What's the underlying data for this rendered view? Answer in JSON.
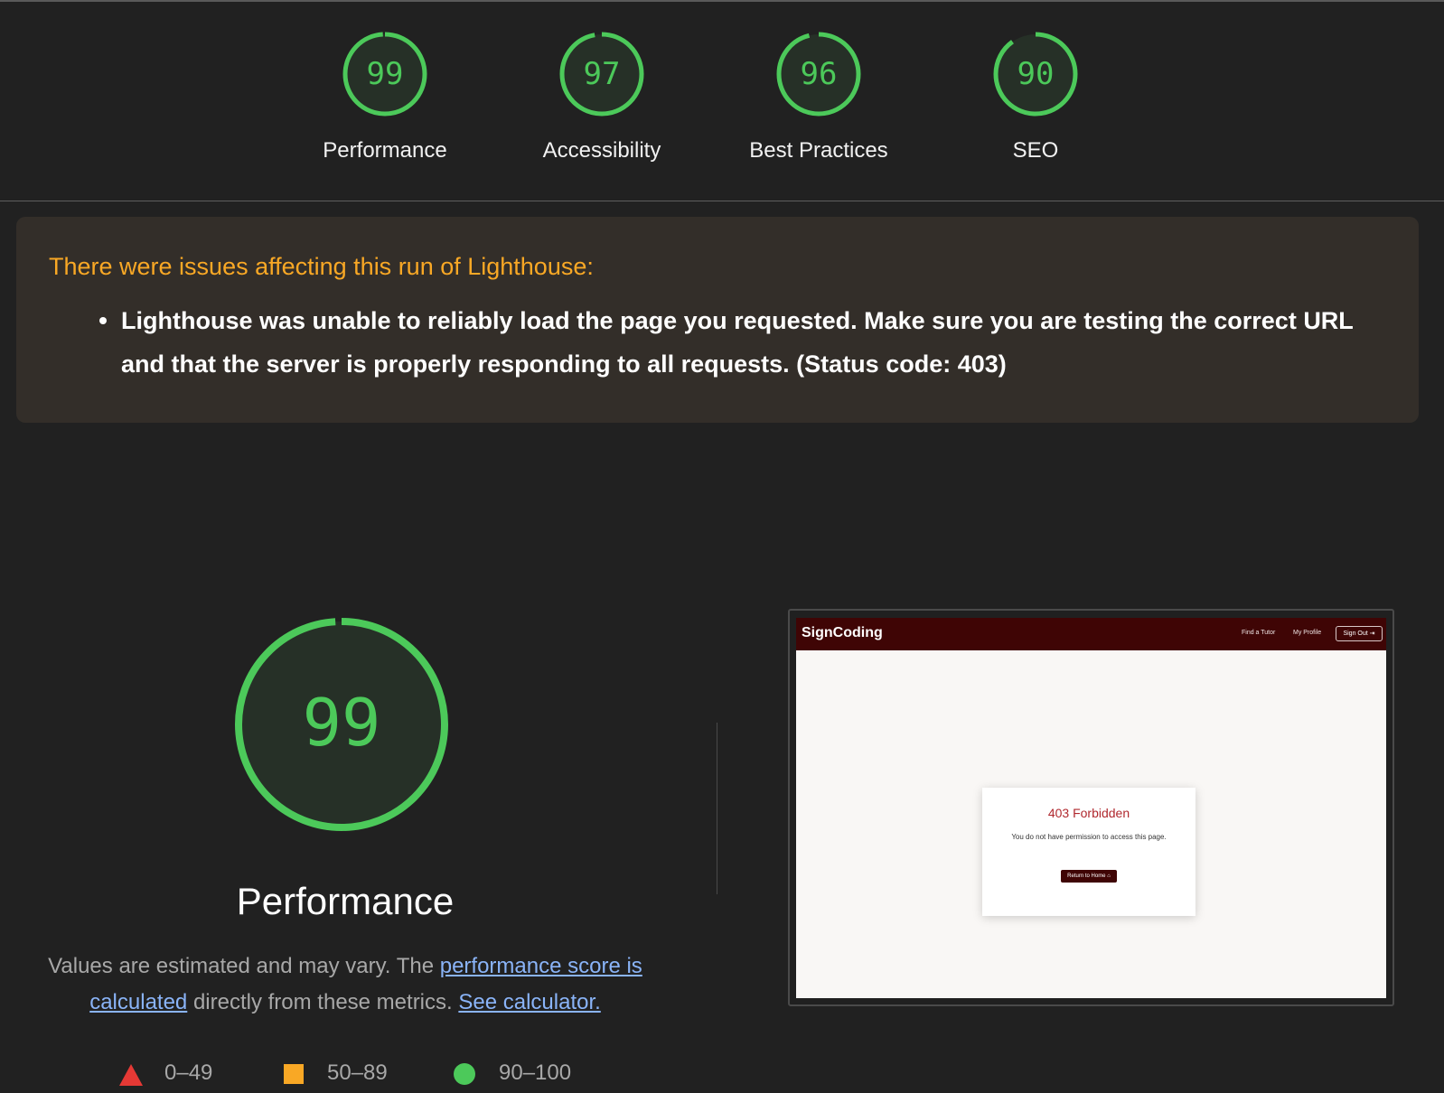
{
  "scores": [
    {
      "label": "Performance",
      "value": "99",
      "fraction": 0.99
    },
    {
      "label": "Accessibility",
      "value": "97",
      "fraction": 0.97
    },
    {
      "label": "Best Practices",
      "value": "96",
      "fraction": 0.96
    },
    {
      "label": "SEO",
      "value": "90",
      "fraction": 0.9
    }
  ],
  "warning": {
    "title": "There were issues affecting this run of Lighthouse:",
    "items": [
      "Lighthouse was unable to reliably load the page you requested. Make sure you are testing the correct URL and that the server is properly responding to all requests. (Status code: 403)"
    ]
  },
  "performance": {
    "score": "99",
    "fraction": 0.99,
    "title": "Performance",
    "desc_1": "Values are estimated and may vary. The ",
    "desc_link_1": "performance score is calculated",
    "desc_2": " directly from these metrics. ",
    "desc_link_2": "See calculator."
  },
  "legend": [
    {
      "label": "0–49",
      "shape": "triangle",
      "color": "#e53935"
    },
    {
      "label": "50–89",
      "shape": "square",
      "color": "#f9a825"
    },
    {
      "label": "90–100",
      "shape": "circle",
      "color": "#4cc95a"
    }
  ],
  "screenshot": {
    "brand": "SignCoding",
    "nav_links": [
      "Find a Tutor",
      "My Profile"
    ],
    "sign_out": "Sign Out",
    "card_title": "403 Forbidden",
    "card_text": "You do not have permission to access this page.",
    "card_button": "Return to Home"
  },
  "colors": {
    "pass": "#4cc95a",
    "gauge_bg": "#263027",
    "warning_title": "#f9a825",
    "link": "#8ab4f8"
  }
}
